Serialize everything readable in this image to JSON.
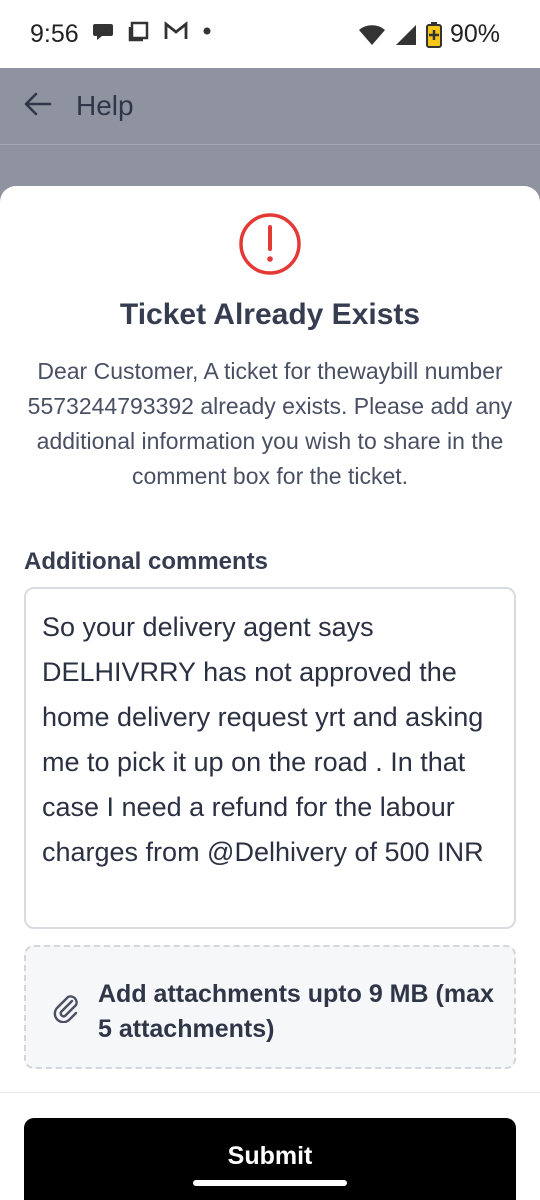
{
  "status_bar": {
    "time": "9:56",
    "battery": "90%",
    "icons_left": [
      "chat-icon",
      "square-icon",
      "gmail-icon",
      "dot-icon"
    ],
    "icons_right": [
      "wifi-icon",
      "signal-icon",
      "battery-icon"
    ]
  },
  "app_bar": {
    "title": "Help"
  },
  "sheet": {
    "title": "Ticket Already Exists",
    "message": "Dear Customer, A ticket for thewaybill number 5573244793392 already exists. Please add any additional information you wish to share in the comment box for the ticket.",
    "comments_label": "Additional comments",
    "comment_value": "So your delivery agent says DELHIVRRY has not approved the home delivery request yrt and asking me to pick it up on the road . In that case I need a refund for the labour charges from @Delhivery of 500 INR",
    "attach_label": "Add attachments upto 9 MB (max 5 attachments)",
    "submit_label": "Submit"
  },
  "colors": {
    "alert_red": "#e53935",
    "overlay": "#8f939f",
    "button_bg": "#000000"
  }
}
